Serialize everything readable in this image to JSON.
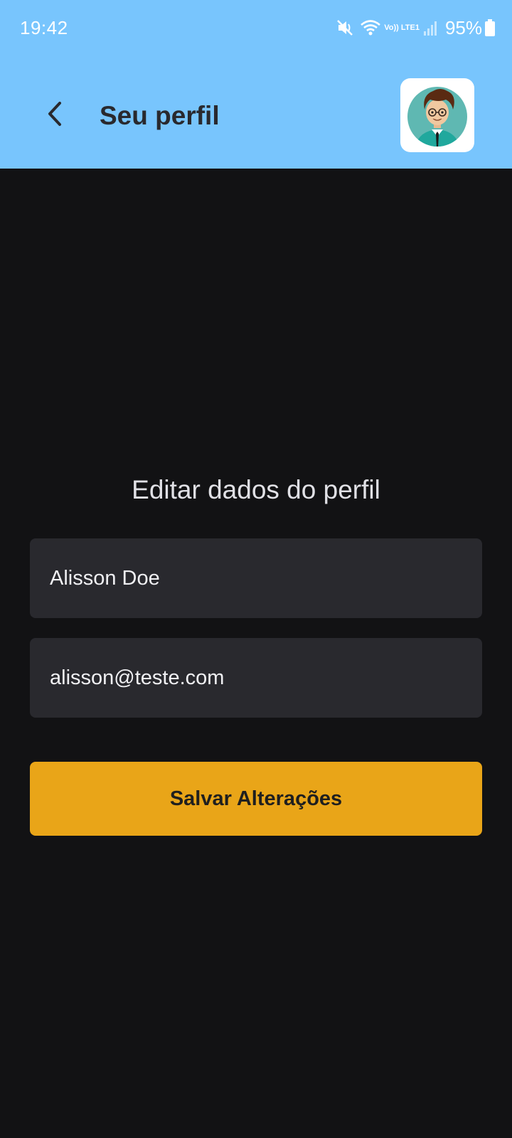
{
  "status_bar": {
    "time": "19:42",
    "network_label": "Vo)) LTE1",
    "battery": "95%"
  },
  "header": {
    "title": "Seu perfil",
    "back_icon": "chevron-left-icon",
    "avatar_icon": "user-avatar-icon"
  },
  "form": {
    "title": "Editar dados do perfil",
    "name_value": "Alisson Doe",
    "email_value": "alisson@teste.com",
    "save_label": "Salvar Alterações"
  },
  "colors": {
    "header_bg": "#78c5fd",
    "page_bg": "#121214",
    "field_bg": "#29292e",
    "button_bg": "#e9a518",
    "title_text": "#29292e"
  }
}
